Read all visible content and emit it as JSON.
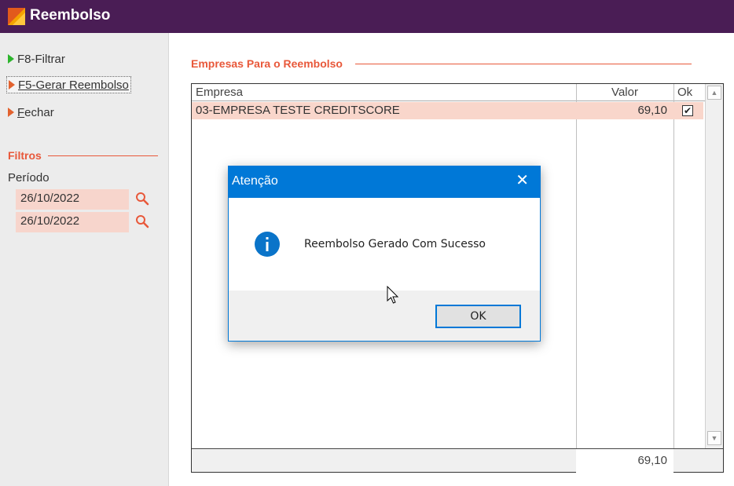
{
  "window": {
    "title": "Reembolso"
  },
  "sidebar": {
    "items": [
      {
        "label": "F8-Filtrar"
      },
      {
        "label": "F5-Gerar Reembolso"
      },
      {
        "label": "Fechar"
      }
    ],
    "filters_title": "Filtros",
    "period_label": "Período",
    "date_start": "26/10/2022",
    "date_end": "26/10/2022"
  },
  "main": {
    "section_title": "Empresas Para o Reembolso",
    "columns": [
      "Empresa",
      "Valor",
      "Ok"
    ],
    "rows": [
      {
        "empresa": "03-EMPRESA TESTE CREDITSCORE",
        "valor": "69,10",
        "ok": true
      }
    ],
    "total": "69,10"
  },
  "dialog": {
    "title": "Atenção",
    "message": "Reembolso Gerado Com Sucesso",
    "ok_label": "OK"
  },
  "colors": {
    "titlebar": "#4a1d55",
    "accent": "#e8583a",
    "row_highlight": "#f9d6cb",
    "dialog_blue": "#0078d7"
  }
}
